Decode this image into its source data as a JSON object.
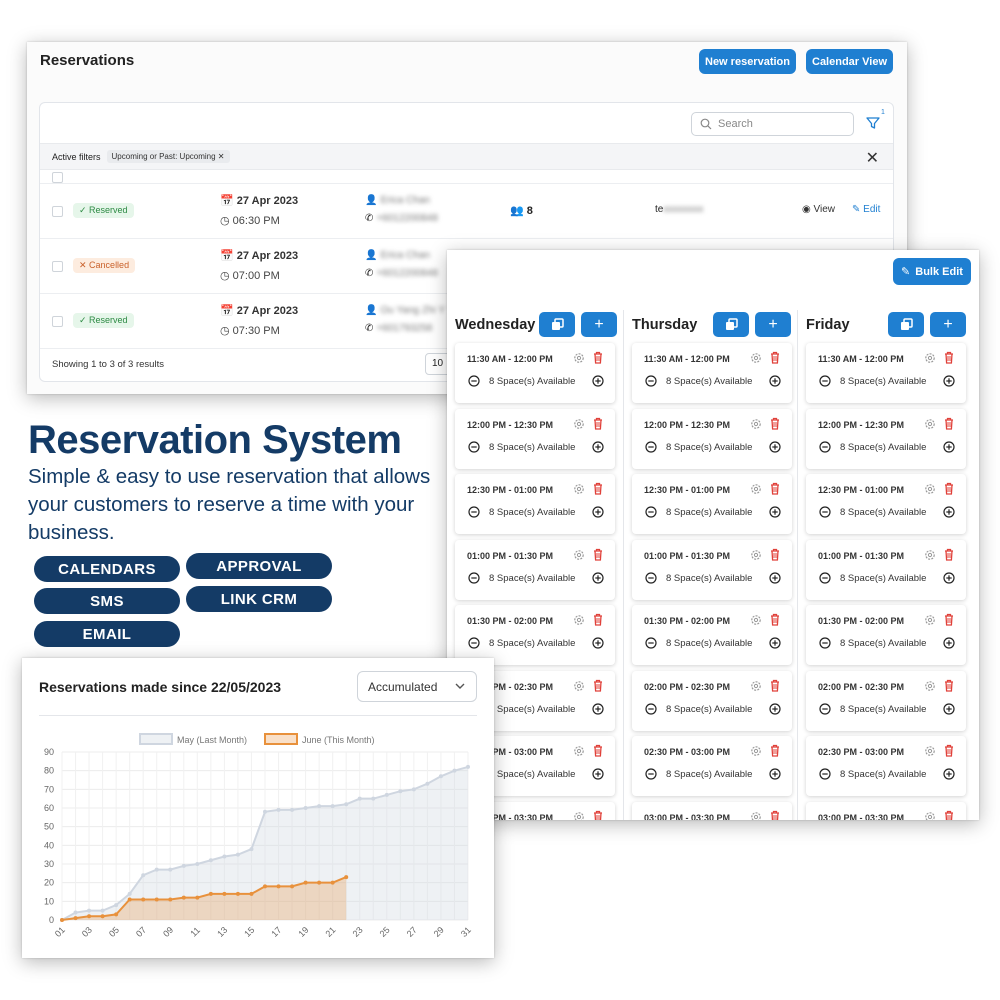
{
  "reservations": {
    "title": "Reservations",
    "new_label": "New reservation",
    "calendar_label": "Calendar View",
    "search_placeholder": "Search",
    "filter_count": "1",
    "active_filters_label": "Active filters",
    "filter_chip": "Upcoming or Past: Upcoming",
    "rows": [
      {
        "status": "Reserved",
        "date": "27 Apr 2023",
        "time": "06:30 PM",
        "name": "Erica Chan",
        "phone": "+6012200848",
        "guests": "8",
        "table": "te",
        "table_blur": "xxxxxxxx",
        "view": "View",
        "edit": "Edit"
      },
      {
        "status": "Cancelled",
        "date": "27 Apr 2023",
        "time": "07:00 PM",
        "name": "Erica Chan",
        "phone": "+6012200848"
      },
      {
        "status": "Reserved",
        "date": "27 Apr 2023",
        "time": "07:30 PM",
        "name": "Ou Yang Zhi Y",
        "phone": "+601793258"
      }
    ],
    "footer": "Showing 1 to 3 of 3 results",
    "page_size": "10"
  },
  "promo": {
    "headline": "Reservation System",
    "tagline": "Simple & easy to use reservation that allows your customers to reserve a time with your business.",
    "features": [
      "CALENDARS",
      "APPROVAL",
      "SMS",
      "LINK CRM",
      "EMAIL"
    ],
    "color": "#143b66"
  },
  "calendar": {
    "bulk_edit_label": "Bulk Edit",
    "accent": "#1f7fd1",
    "days": [
      "Wednesday",
      "Thursday",
      "Friday"
    ],
    "slots": [
      "11:30 AM - 12:00 PM",
      "12:00 PM - 12:30 PM",
      "12:30 PM - 01:00 PM",
      "01:00 PM - 01:30 PM",
      "01:30 PM - 02:00 PM",
      "02:00 PM - 02:30 PM",
      "02:30 PM - 03:00 PM",
      "03:00 PM - 03:30 PM"
    ],
    "availability": "8 Space(s) Available"
  },
  "chart": {
    "title": "Reservations made since 22/05/2023",
    "select_value": "Accumulated"
  },
  "chart_data": {
    "type": "area",
    "title": "Reservations made since 22/05/2023",
    "ylim": [
      0,
      90
    ],
    "yticks": [
      0,
      10,
      20,
      30,
      40,
      50,
      60,
      70,
      80,
      90
    ],
    "xticks": [
      "01",
      "03",
      "05",
      "07",
      "09",
      "11",
      "13",
      "15",
      "17",
      "19",
      "21",
      "23",
      "25",
      "27",
      "29",
      "31"
    ],
    "grid": true,
    "legend": "top-center",
    "series": [
      {
        "name": "May (Last Month)",
        "color": "#cfd6e0",
        "x": [
          1,
          2,
          3,
          4,
          5,
          6,
          7,
          8,
          9,
          10,
          11,
          12,
          13,
          14,
          15,
          16,
          17,
          18,
          19,
          20,
          21,
          22,
          23,
          24,
          25,
          26,
          27,
          28,
          29,
          30,
          31
        ],
        "values": [
          0,
          4,
          5,
          5,
          8,
          14,
          24,
          27,
          27,
          29,
          30,
          32,
          34,
          35,
          38,
          58,
          59,
          59,
          60,
          61,
          61,
          62,
          65,
          65,
          67,
          69,
          70,
          73,
          77,
          80,
          82
        ]
      },
      {
        "name": "June (This Month)",
        "color": "#e8913c",
        "x": [
          1,
          2,
          3,
          4,
          5,
          6,
          7,
          8,
          9,
          10,
          11,
          12,
          13,
          14,
          15,
          16,
          17,
          18,
          19,
          20,
          21,
          22
        ],
        "values": [
          0,
          1,
          2,
          2,
          3,
          11,
          11,
          11,
          11,
          12,
          12,
          14,
          14,
          14,
          14,
          18,
          18,
          18,
          20,
          20,
          20,
          23
        ]
      }
    ]
  }
}
